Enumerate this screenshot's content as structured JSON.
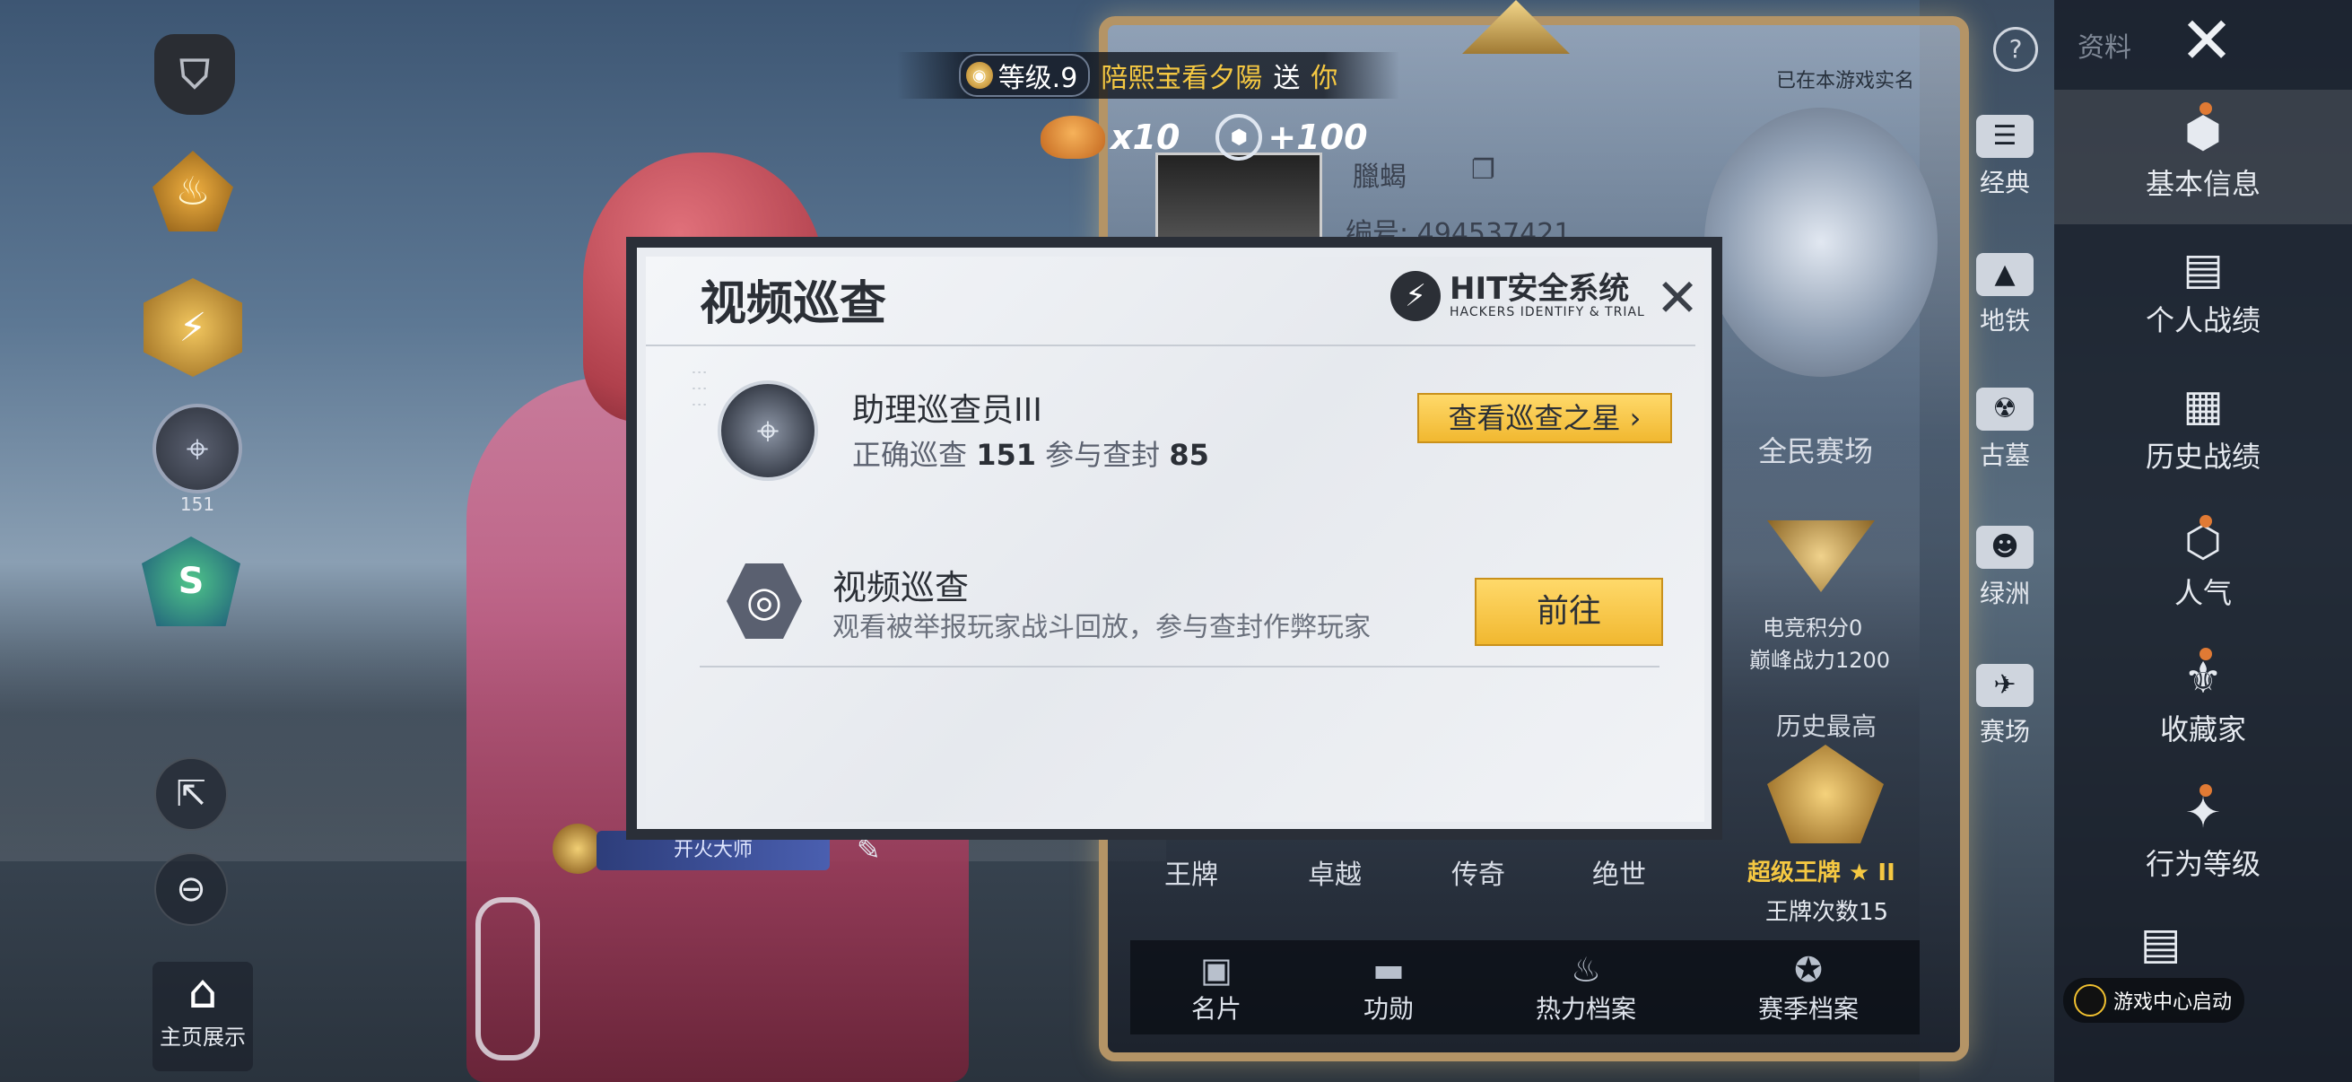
{
  "gift": {
    "level_label": "等级.9",
    "sender": "陪熙宝看夕陽",
    "send_word": "送",
    "receiver": "你",
    "food_count": "x10",
    "coin_amount": "+100"
  },
  "left_column": {
    "rifle_badge_number": "151",
    "rank_badge_letter": "S",
    "home_show_label": "主页展示"
  },
  "profile": {
    "name": "臘蝎",
    "id_label": "编号: 494537421",
    "verified_text": "已在本游戏实名",
    "name_plate": "开火大师",
    "all_arena": "全民赛场",
    "esport_score": "电竞积分0",
    "peak_power": "巅峰战力1200",
    "history_high": "历史最高",
    "super_ace": "超级王牌 ★ II",
    "ace_count": "王牌次数15",
    "tiers": [
      "王牌",
      "卓越",
      "传奇",
      "绝世"
    ],
    "bottom_tabs": [
      {
        "label": "名片",
        "icon": "card-icon"
      },
      {
        "label": "功勋",
        "icon": "merit-icon"
      },
      {
        "label": "热力档案",
        "icon": "heat-icon"
      },
      {
        "label": "赛季档案",
        "icon": "season-icon"
      }
    ]
  },
  "mid_tabs": [
    {
      "label": "经典",
      "icon": "classic-icon"
    },
    {
      "label": "地铁",
      "icon": "metro-icon"
    },
    {
      "label": "古墓",
      "icon": "tomb-icon"
    },
    {
      "label": "绿洲",
      "icon": "oasis-icon"
    },
    {
      "label": "赛场",
      "icon": "arena-icon"
    }
  ],
  "right_panel": {
    "title": "资料",
    "tabs": [
      {
        "label": "基本信息",
        "icon": "basic-info-icon"
      },
      {
        "label": "个人战绩",
        "icon": "personal-record-icon"
      },
      {
        "label": "历史战绩",
        "icon": "history-record-icon"
      },
      {
        "label": "人气",
        "icon": "popularity-icon"
      },
      {
        "label": "收藏家",
        "icon": "collector-icon"
      },
      {
        "label": "行为等级",
        "icon": "behavior-level-icon"
      }
    ],
    "game_center": "游戏中心启动"
  },
  "modal": {
    "title": "视频巡查",
    "logo_name": "HIT安全系统",
    "logo_sub": "HACKERS IDENTIFY & TRIAL",
    "rank_title": "助理巡查员III",
    "stats_label_correct": "正确巡查",
    "stats_correct": "151",
    "stats_label_ban": "参与查封",
    "stats_ban": "85",
    "star_button": "查看巡查之星 ›",
    "video_title": "视频巡查",
    "video_desc": "观看被举报玩家战斗回放，参与查封作弊玩家",
    "go_button": "前往"
  }
}
